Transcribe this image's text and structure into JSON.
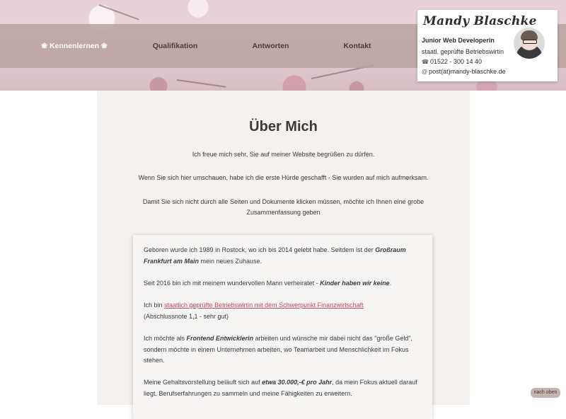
{
  "nav": {
    "items": [
      {
        "label": "❀ Kennenlernen ❀",
        "active": true
      },
      {
        "label": "Qualifikation",
        "active": false
      },
      {
        "label": "Antworten",
        "active": false
      },
      {
        "label": "Kontakt",
        "active": false
      }
    ]
  },
  "profile": {
    "name": "Mandy Blaschke",
    "role": "Junior Web Developerin",
    "subtitle": "staatl. geprüfte Betriebswirtin",
    "phone": "01522 - 300 14 40",
    "email": "post(at)mandy-blaschke.de",
    "phone_icon": "phone-icon",
    "email_icon": "at-icon"
  },
  "main": {
    "title": "Über Mich",
    "intro": [
      "Ich freue mich sehr, Sie auf meiner Website begrüßen zu dürfen.",
      "Wenn Sie sich hier umschauen, habe ich die erste Hürde geschafft - Sie wurden auf mich aufmerksam.",
      "Damit Sie sich nicht durch alle Seiten und Dokumente klicken müssen, möchte ich Ihnen eine grobe Zusammenfassung geben"
    ],
    "box": {
      "p1_pre": "Geboren wurde ich 1989 in Rostock, wo ich bis 2014 gelebt habe. Seitdem ist der ",
      "p1_bold": "Großraum Frankfurt am Main",
      "p1_post": " mein neues Zuhause.",
      "p2_pre": "Seit 2016 bin ich mit meinem wundervollen Mann verheiratet - ",
      "p2_bold": "Kinder haben wir keine",
      "p2_post": ".",
      "p3_pre": "Ich bin ",
      "p3_link": "staatlich geprüfte Betriebswirtin mit dem Schwerpunkt Finanzwirtschaft",
      "p3_post": " (Abschlussnote 1,1 - sehr gut)",
      "p4_pre": "Ich möchte als ",
      "p4_bold": "Frontend Entwicklerin",
      "p4_post": " arbeiten und wünsche mir dabei nicht das \"große Geld\", sondern möchte in einem Unternehmen arbeiten, wo Teamarbeit und Menschlichkeit im Fokus stehen.",
      "p5_pre": "Meine Gehaltsvorstellung beläuft sich auf ",
      "p5_bold": "etwa 30.000,-€ pro Jahr",
      "p5_post": ", da mein Fokus aktuell darauf liegt, Berufserfahrungen zu sammeln und meine Fähigkeiten zu erweitern."
    }
  },
  "back_to_top": "nach oben",
  "colors": {
    "nav_bg": "#baa0a0",
    "link": "#c44a5a",
    "content_bg": "#f4f1ef"
  }
}
